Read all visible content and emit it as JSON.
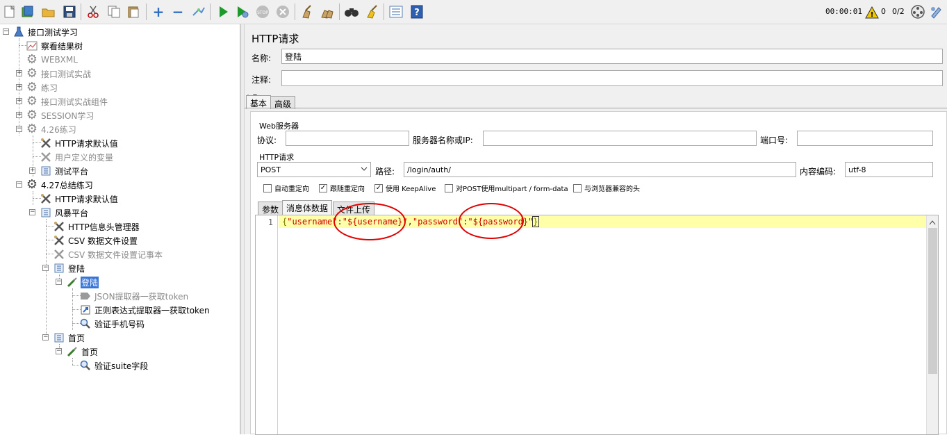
{
  "toolbar": {
    "icons": [
      "new-icon",
      "templates-icon",
      "open-icon",
      "save-icon",
      "cut-icon",
      "copy-icon",
      "paste-icon",
      "expand-icon",
      "collapse-icon",
      "toggle-icon",
      "start-icon",
      "start-no-pause-icon",
      "stop-icon",
      "shutdown-icon",
      "clear-icon",
      "clear-all-icon",
      "search-icon",
      "reset-search-icon",
      "function-helper-icon",
      "help-icon"
    ],
    "timer": "00:00:01",
    "warning_count": "0",
    "threads": "0/2"
  },
  "tree": {
    "root": "接口测试学习",
    "items": [
      {
        "label": "察看结果树"
      },
      {
        "label": "WEBXML"
      },
      {
        "label": "接口测试实战"
      },
      {
        "label": "练习"
      },
      {
        "label": "接口测试实战组件"
      },
      {
        "label": "SESSION学习"
      },
      {
        "label": "4.26练习"
      },
      {
        "label": "HTTP请求默认值"
      },
      {
        "label": "用户定义的变量"
      },
      {
        "label": "测试平台"
      },
      {
        "label": "4.27总结练习"
      },
      {
        "label": "HTTP请求默认值"
      },
      {
        "label": "风暴平台"
      },
      {
        "label": "HTTP信息头管理器"
      },
      {
        "label": "CSV 数据文件设置"
      },
      {
        "label": "CSV 数据文件设置记事本"
      },
      {
        "label": "登陆"
      },
      {
        "label": "登陆"
      },
      {
        "label": "JSON提取器一获取token"
      },
      {
        "label": "正则表达式提取器一获取token"
      },
      {
        "label": "验证手机号码"
      },
      {
        "label": "首页"
      },
      {
        "label": "首页"
      },
      {
        "label": "验证suite字段"
      }
    ]
  },
  "panel": {
    "title": "HTTP请求",
    "name_label": "名称:",
    "name_value": "登陆",
    "comment_label": "注释:",
    "comment_value": "",
    "tabs": [
      "基本",
      "高级"
    ],
    "web_server": {
      "group_title": "Web服务器",
      "protocol_label": "协议:",
      "protocol_value": "",
      "server_label": "服务器名称或IP:",
      "server_value": "",
      "port_label": "端口号:",
      "port_value": ""
    },
    "http_request": {
      "group_title": "HTTP请求",
      "method": "POST",
      "path_label": "路径:",
      "path_value": "/login/auth/",
      "encoding_label": "内容编码:",
      "encoding_value": "utf-8"
    },
    "options": [
      {
        "label": "自动重定向",
        "checked": false
      },
      {
        "label": "跟随重定向",
        "checked": true
      },
      {
        "label": "使用 KeepAlive",
        "checked": true
      },
      {
        "label": "对POST使用multipart / form-data",
        "checked": false
      },
      {
        "label": "与浏览器兼容的头",
        "checked": false
      }
    ],
    "body_tabs": [
      "参数",
      "消息体数据",
      "文件上传"
    ],
    "editor": {
      "line_number": "1",
      "tok_open": "{",
      "tok_key1": "\"username\"",
      "tok_colon1": ":",
      "tok_val1": "\"${username}\"",
      "tok_comma": ",",
      "tok_key2": "\"password\"",
      "tok_colon2": ":",
      "tok_val2": "\"${password}\"",
      "tok_close": "}"
    }
  }
}
